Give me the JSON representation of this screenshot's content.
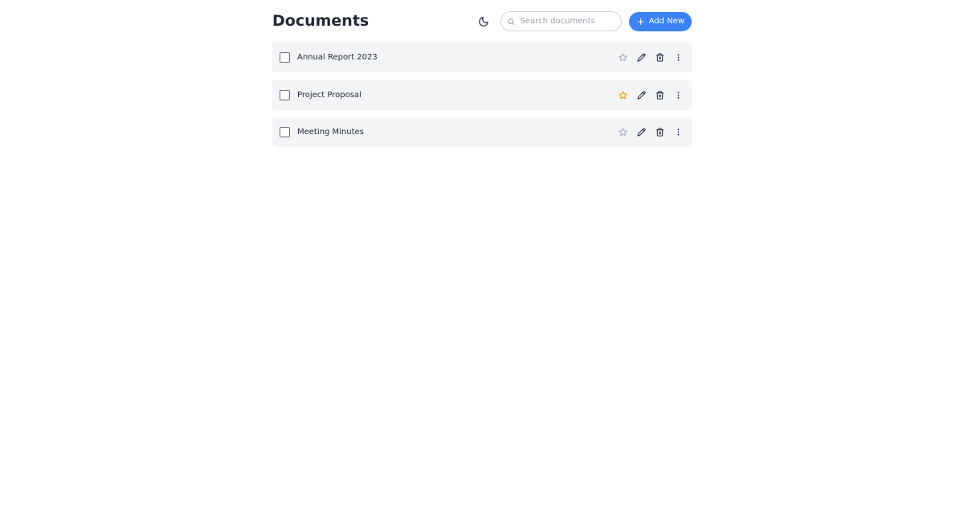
{
  "header": {
    "title": "Documents",
    "theme_toggle_icon": "moon-icon",
    "search_placeholder": "Search documents",
    "search_value": "",
    "add_button_label": "Add New",
    "add_button_icon": "plus-icon"
  },
  "colors": {
    "accent": "#3b82f6",
    "row_background": "#f3f4f6",
    "star_active": "#f59e0b",
    "star_inactive": "#9ca3af"
  },
  "documents": [
    {
      "name": "Annual Report 2023",
      "starred": false,
      "checked": false
    },
    {
      "name": "Project Proposal",
      "starred": true,
      "checked": false
    },
    {
      "name": "Meeting Minutes",
      "starred": false,
      "checked": false
    }
  ],
  "row_actions": [
    "star-icon",
    "edit-icon",
    "trash-icon",
    "more-vertical-icon"
  ]
}
